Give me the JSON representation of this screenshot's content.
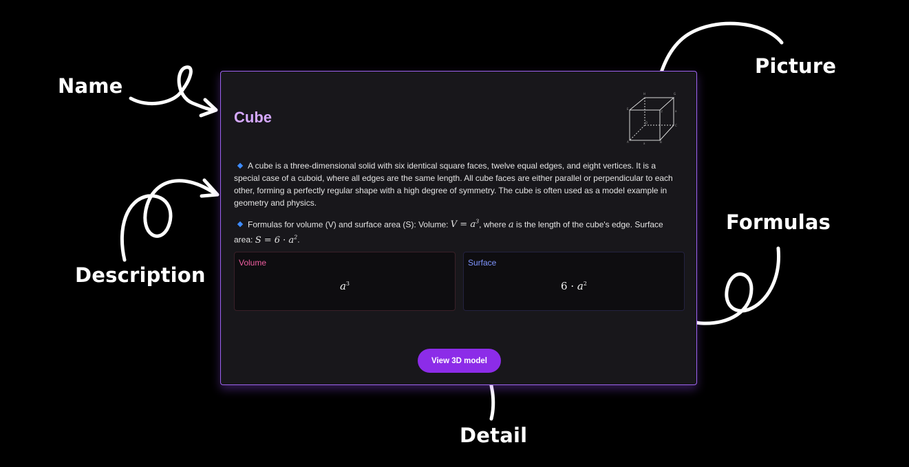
{
  "annotations": {
    "name": "Name",
    "picture": "Picture",
    "description": "Description",
    "formulas": "Formulas",
    "detail": "Detail"
  },
  "card": {
    "title": "Cube",
    "picture_icon": "cube-wireframe",
    "description": {
      "p1": "A cube is a three-dimensional solid with six identical square faces, twelve equal edges, and eight vertices. It is a special case of a cuboid, where all edges are the same length. All cube faces are either parallel or perpendicular to each other, forming a perfectly regular shape with a high degree of symmetry. The cube is often used as a model example in geometry and physics.",
      "p2_prefix": "Formulas for volume (V) and surface area (S): Volume: ",
      "p2_volume_formula": "V = a",
      "p2_mid": ", where ",
      "p2_var": "a",
      "p2_suffix": " is the length of the cube's edge. Surface area: ",
      "p2_surface_formula": "S = 6 · a",
      "p2_end": "."
    },
    "formulas": [
      {
        "label": "Volume",
        "base": "a",
        "exp": "3",
        "color": "#ef5da0"
      },
      {
        "label": "Surface",
        "coef": "6 · ",
        "base": "a",
        "exp": "2",
        "color": "#7f95ff"
      }
    ],
    "button_label": "View 3D model"
  },
  "colors": {
    "background": "#000000",
    "card_background": "#18171b",
    "card_border": "#9d63f0",
    "title": "#d5a8ff",
    "bullet": "#3d8bfd",
    "button": "#8c2ce8"
  }
}
